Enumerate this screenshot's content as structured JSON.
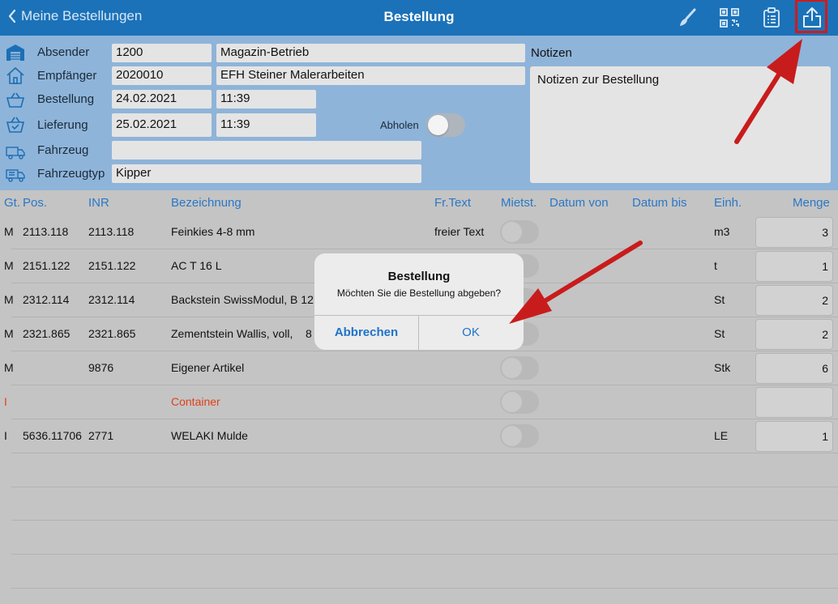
{
  "nav": {
    "back_label": "Meine Bestellungen",
    "title": "Bestellung",
    "icons": [
      "brush-icon",
      "qr-code-icon",
      "clipboard-icon",
      "upload-icon"
    ],
    "bar_color": "#1b72b8"
  },
  "header": {
    "absender": {
      "label": "Absender",
      "code": "1200",
      "name": "Magazin-Betrieb"
    },
    "empfaenger": {
      "label": "Empfänger",
      "code": "2020010",
      "name": "EFH Steiner Malerarbeiten"
    },
    "bestellung": {
      "label": "Bestellung",
      "date": "24.02.2021",
      "time": "11:39"
    },
    "lieferung": {
      "label": "Lieferung",
      "date": "25.02.2021",
      "time": "11:39"
    },
    "abholen_label": "Abholen",
    "abholen_on": false,
    "fahrzeug": {
      "label": "Fahrzeug",
      "value": ""
    },
    "fahrzeugtyp": {
      "label": "Fahrzeugtyp",
      "value": "Kipper"
    },
    "notes_label": "Notizen",
    "notes_value": "Notizen zur Bestellung"
  },
  "table": {
    "columns": [
      "Gt.",
      "Pos.",
      "INR",
      "Bezeichnung",
      "Fr.Text",
      "Mietst.",
      "Datum von",
      "Datum bis",
      "Einh.",
      "Menge"
    ],
    "rows": [
      {
        "gt": "M",
        "pos": "2113.118",
        "inr": "2113.118",
        "bez": "Feinkies 4-8 mm",
        "frtext": "freier Text",
        "einh": "m3",
        "menge": "3"
      },
      {
        "gt": "M",
        "pos": "2151.122",
        "inr": "2151.122",
        "bez": "AC T 16 L",
        "frtext": "",
        "einh": "t",
        "menge": "1"
      },
      {
        "gt": "M",
        "pos": "2312.114",
        "inr": "2312.114",
        "bez": "Backstein SwissModul, B 12",
        "frtext": "",
        "einh": "St",
        "menge": "2"
      },
      {
        "gt": "M",
        "pos": "2321.865",
        "inr": "2321.865",
        "bez": "Zementstein Wallis, voll,    8",
        "frtext": "",
        "einh": "St",
        "menge": "2"
      },
      {
        "gt": "M",
        "pos": "",
        "inr": "9876",
        "bez": "Eigener Artikel",
        "frtext": "",
        "einh": "Stk",
        "menge": "6"
      },
      {
        "gt": "I",
        "pos": "",
        "inr": "",
        "bez": "Container",
        "frtext": "",
        "einh": "",
        "menge": ""
      },
      {
        "gt": "I",
        "pos": "5636.11706",
        "inr": "2771",
        "bez": "WELAKI Mulde",
        "frtext": "",
        "einh": "LE",
        "menge": "1"
      }
    ]
  },
  "dialog": {
    "title": "Bestellung",
    "message": "Möchten Sie die Bestellung abgeben?",
    "cancel_label": "Abbrechen",
    "ok_label": "OK"
  },
  "annotation_color": "#d11a1a"
}
